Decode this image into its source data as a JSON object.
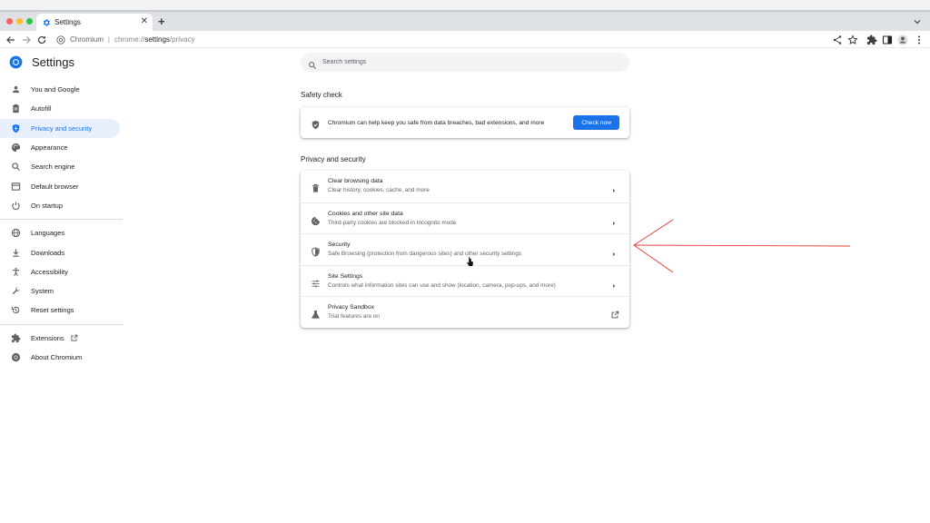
{
  "browser": {
    "tab_title": "Settings",
    "omnibox": {
      "origin_label": "Chromium",
      "separator": "|",
      "scheme": "chrome://",
      "host": "settings",
      "path": "/privacy"
    }
  },
  "header": {
    "title": "Settings",
    "search_placeholder": "Search settings"
  },
  "sidebar": {
    "items": [
      {
        "label": "You and Google",
        "icon": "person-icon"
      },
      {
        "label": "Autofill",
        "icon": "clipboard-icon"
      },
      {
        "label": "Privacy and security",
        "icon": "shield-icon",
        "active": true
      },
      {
        "label": "Appearance",
        "icon": "palette-icon"
      },
      {
        "label": "Search engine",
        "icon": "search-icon"
      },
      {
        "label": "Default browser",
        "icon": "browser-icon"
      },
      {
        "label": "On startup",
        "icon": "power-icon"
      },
      {
        "label": "Languages",
        "icon": "globe-icon"
      },
      {
        "label": "Downloads",
        "icon": "download-icon"
      },
      {
        "label": "Accessibility",
        "icon": "accessibility-icon"
      },
      {
        "label": "System",
        "icon": "wrench-icon"
      },
      {
        "label": "Reset settings",
        "icon": "history-icon"
      },
      {
        "label": "Extensions",
        "icon": "puzzle-icon"
      },
      {
        "label": "About Chromium",
        "icon": "chromium-icon"
      }
    ]
  },
  "safety_check": {
    "heading": "Safety check",
    "text": "Chromium can help keep you safe from data breaches, bad extensions, and more",
    "button_label": "Check now"
  },
  "privacy_section": {
    "heading": "Privacy and security",
    "rows": [
      {
        "title": "Clear browsing data",
        "subtitle": "Clear history, cookies, cache, and more",
        "icon": "trash-icon"
      },
      {
        "title": "Cookies and other site data",
        "subtitle": "Third-party cookies are blocked in Incognito mode",
        "icon": "cookie-icon"
      },
      {
        "title": "Security",
        "subtitle": "Safe Browsing (protection from dangerous sites) and other security settings",
        "icon": "security-shield-icon"
      },
      {
        "title": "Site Settings",
        "subtitle": "Controls what information sites can use and show (location, camera, pop-ups, and more)",
        "icon": "sliders-icon"
      },
      {
        "title": "Privacy Sandbox",
        "subtitle": "Trial features are on",
        "icon": "flask-icon"
      }
    ]
  },
  "colors": {
    "accent": "#1a73e8",
    "active_nav_bg": "#e8f0fe",
    "annotation_arrow": "#e53935"
  }
}
